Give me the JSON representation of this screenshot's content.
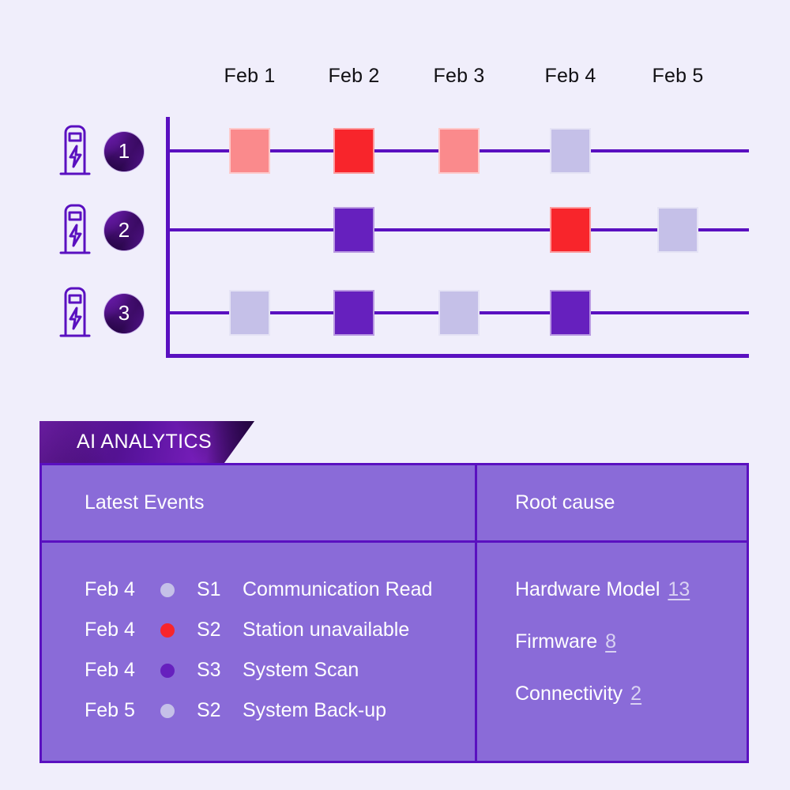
{
  "theme": {
    "background": "#f0eefb",
    "axis_purple": "#5a10c0",
    "deep_purple": "#6620be",
    "light_purple": "#c5c0e8",
    "bright_red": "#f8252b",
    "light_red": "#fa8a8c",
    "table_fill": "#8a6bd8",
    "text_white": "#ffffff",
    "text_dark": "#111014"
  },
  "chart": {
    "dates": [
      "Feb 1",
      "Feb 2",
      "Feb 3",
      "Feb 4",
      "Feb 5"
    ],
    "stations": [
      {
        "number": "1",
        "icon": "ev-charging-station-icon"
      },
      {
        "number": "2",
        "icon": "ev-charging-station-icon"
      },
      {
        "number": "3",
        "icon": "ev-charging-station-icon"
      }
    ]
  },
  "chart_data": {
    "type": "heatmap",
    "title": "",
    "xlabel": "",
    "ylabel": "",
    "categories": [
      "Feb 1",
      "Feb 2",
      "Feb 3",
      "Feb 4",
      "Feb 5"
    ],
    "rows": [
      "1",
      "2",
      "3"
    ],
    "legend_position": "none",
    "grid": false,
    "color_map": {
      "light_red": "#fa8a8c",
      "bright_red": "#f8252b",
      "light_purple": "#c5c0e8",
      "deep_purple": "#6620be"
    },
    "series": [
      {
        "name": "1",
        "values": [
          "light_red",
          "bright_red",
          "light_red",
          "light_purple",
          null
        ]
      },
      {
        "name": "2",
        "values": [
          null,
          "deep_purple",
          null,
          "bright_red",
          "light_purple"
        ]
      },
      {
        "name": "3",
        "values": [
          "light_purple",
          "deep_purple",
          "light_purple",
          "deep_purple",
          null
        ]
      }
    ]
  },
  "analytics": {
    "tab_label": "AI ANALYTICS",
    "headers": {
      "events": "Latest Events",
      "root_cause": "Root cause"
    },
    "events": [
      {
        "date": "Feb 4",
        "dot": "#c5c0e8",
        "station": "S1",
        "description": "Communication Read"
      },
      {
        "date": "Feb 4",
        "dot": "#f8252b",
        "station": "S2",
        "description": "Station unavailable"
      },
      {
        "date": "Feb 4",
        "dot": "#6620be",
        "station": "S3",
        "description": "System Scan"
      },
      {
        "date": "Feb 5",
        "dot": "#c5c0e8",
        "station": "S2",
        "description": "System Back-up"
      }
    ],
    "root_causes": [
      {
        "label": "Hardware Model",
        "count": "13"
      },
      {
        "label": "Firmware",
        "count": "8"
      },
      {
        "label": "Connectivity",
        "count": "2"
      }
    ]
  }
}
